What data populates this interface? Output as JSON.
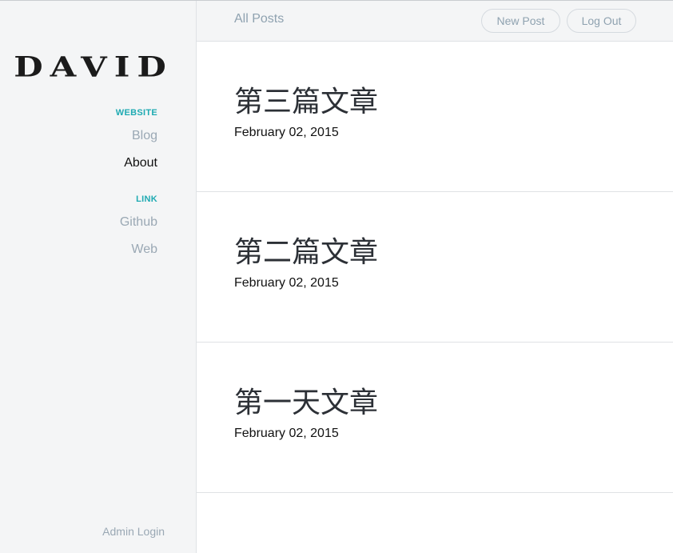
{
  "sidebar": {
    "logo": "DAVID",
    "sections": [
      {
        "heading": "WEBSITE",
        "items": [
          {
            "label": "Blog",
            "active": false
          },
          {
            "label": "About",
            "active": true
          }
        ]
      },
      {
        "heading": "LINK",
        "items": [
          {
            "label": "Github",
            "active": false
          },
          {
            "label": "Web",
            "active": false
          }
        ]
      }
    ],
    "admin_login": "Admin Login"
  },
  "topbar": {
    "title": "All Posts",
    "new_post_label": "New Post",
    "log_out_label": "Log Out"
  },
  "posts": [
    {
      "title": "第三篇文章",
      "date": "February 02, 2015"
    },
    {
      "title": "第二篇文章",
      "date": "February 02, 2015"
    },
    {
      "title": "第一天文章",
      "date": "February 02, 2015"
    }
  ],
  "colors": {
    "accent": "#1eaab2",
    "muted_link": "#9aa8b4",
    "sidebar_bg": "#f4f5f6"
  }
}
